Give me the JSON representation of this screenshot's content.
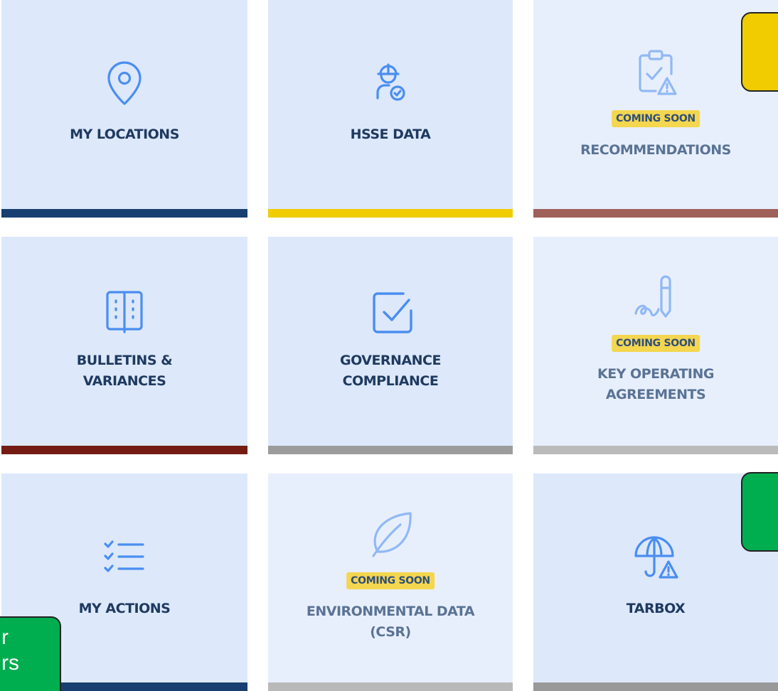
{
  "tiles": [
    {
      "id": "my-locations",
      "label_lines": [
        "MY LOCATIONS"
      ],
      "icon": "map-pin-icon",
      "bar_color": "#173f70",
      "coming_soon": false
    },
    {
      "id": "hsse-data",
      "label_lines": [
        "HSSE DATA"
      ],
      "icon": "hardhat-worker-check-icon",
      "bar_color": "#efcd00",
      "coming_soon": false
    },
    {
      "id": "recommendations",
      "label_lines": [
        "RECOMMENDATIONS"
      ],
      "icon": "clipboard-check-warning-icon",
      "bar_color": "#a0605a",
      "coming_soon": true,
      "badge": "COMING SOON"
    },
    {
      "id": "bulletins-variances",
      "label_lines": [
        "BULLETINS &",
        "VARIANCES"
      ],
      "icon": "open-book-icon",
      "bar_color": "#741c14",
      "coming_soon": false
    },
    {
      "id": "governance-compliance",
      "label_lines": [
        "GOVERNANCE",
        "COMPLIANCE"
      ],
      "icon": "checkbox-icon",
      "bar_color": "#9c9c9c",
      "coming_soon": false
    },
    {
      "id": "key-operating-agreements",
      "label_lines": [
        "KEY OPERATING",
        "AGREEMENTS"
      ],
      "icon": "pen-signature-icon",
      "bar_color": "#bbbbbb",
      "coming_soon": true,
      "badge": "COMING SOON"
    },
    {
      "id": "my-actions",
      "label_lines": [
        "MY ACTIONS"
      ],
      "icon": "checklist-icon",
      "bar_color": "#173f70",
      "coming_soon": false
    },
    {
      "id": "environmental-data",
      "label_lines": [
        "ENVIRONMENTAL DATA",
        "(CSR)"
      ],
      "icon": "leaf-icon",
      "bar_color": "#b9b9b9",
      "coming_soon": true,
      "badge": "COMING SOON"
    },
    {
      "id": "tarbox",
      "label_lines": [
        "TARBOX"
      ],
      "icon": "umbrella-warning-icon",
      "bar_color": "#999999",
      "coming_soon": false
    }
  ],
  "callouts": {
    "yellow": {
      "color": "#f0cc00"
    },
    "green_right": {
      "color": "#00ad4f"
    },
    "green_left": {
      "color": "#00ad4f",
      "lines": [
        "r",
        "rs"
      ]
    }
  },
  "colors": {
    "tile_bg": "#dde8fb",
    "tile_bg_soon": "#e8effc",
    "icon_blue": "#4a8ef0",
    "label_dark": "#1f3a60",
    "label_muted": "#5a7395",
    "badge_bg": "#f4d64f"
  }
}
